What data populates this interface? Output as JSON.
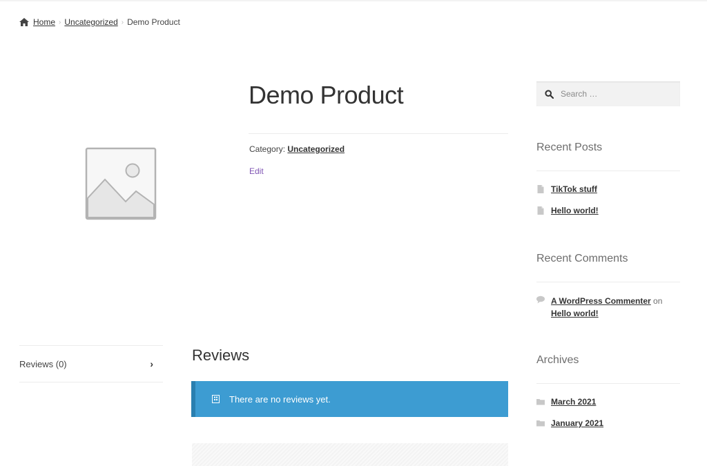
{
  "breadcrumb": {
    "home": "Home",
    "category": "Uncategorized",
    "current": "Demo Product"
  },
  "product": {
    "title": "Demo Product",
    "category_label": "Category:",
    "category": "Uncategorized",
    "edit": "Edit"
  },
  "tabs": {
    "reviews": "Reviews (0)"
  },
  "reviews": {
    "title": "Reviews",
    "notice": "There are no reviews yet."
  },
  "sidebar": {
    "search_placeholder": "Search …",
    "recent_posts_title": "Recent Posts",
    "recent_posts": [
      "TikTok stuff",
      "Hello world!"
    ],
    "recent_comments_title": "Recent Comments",
    "comment_author": "A WordPress Commenter",
    "comment_on": "on",
    "comment_post": "Hello world!",
    "archives_title": "Archives",
    "archives": [
      "March 2021",
      "January 2021"
    ]
  },
  "colors": {
    "notice_bg": "#3d9cd2",
    "edit_link": "#7f54b3"
  }
}
